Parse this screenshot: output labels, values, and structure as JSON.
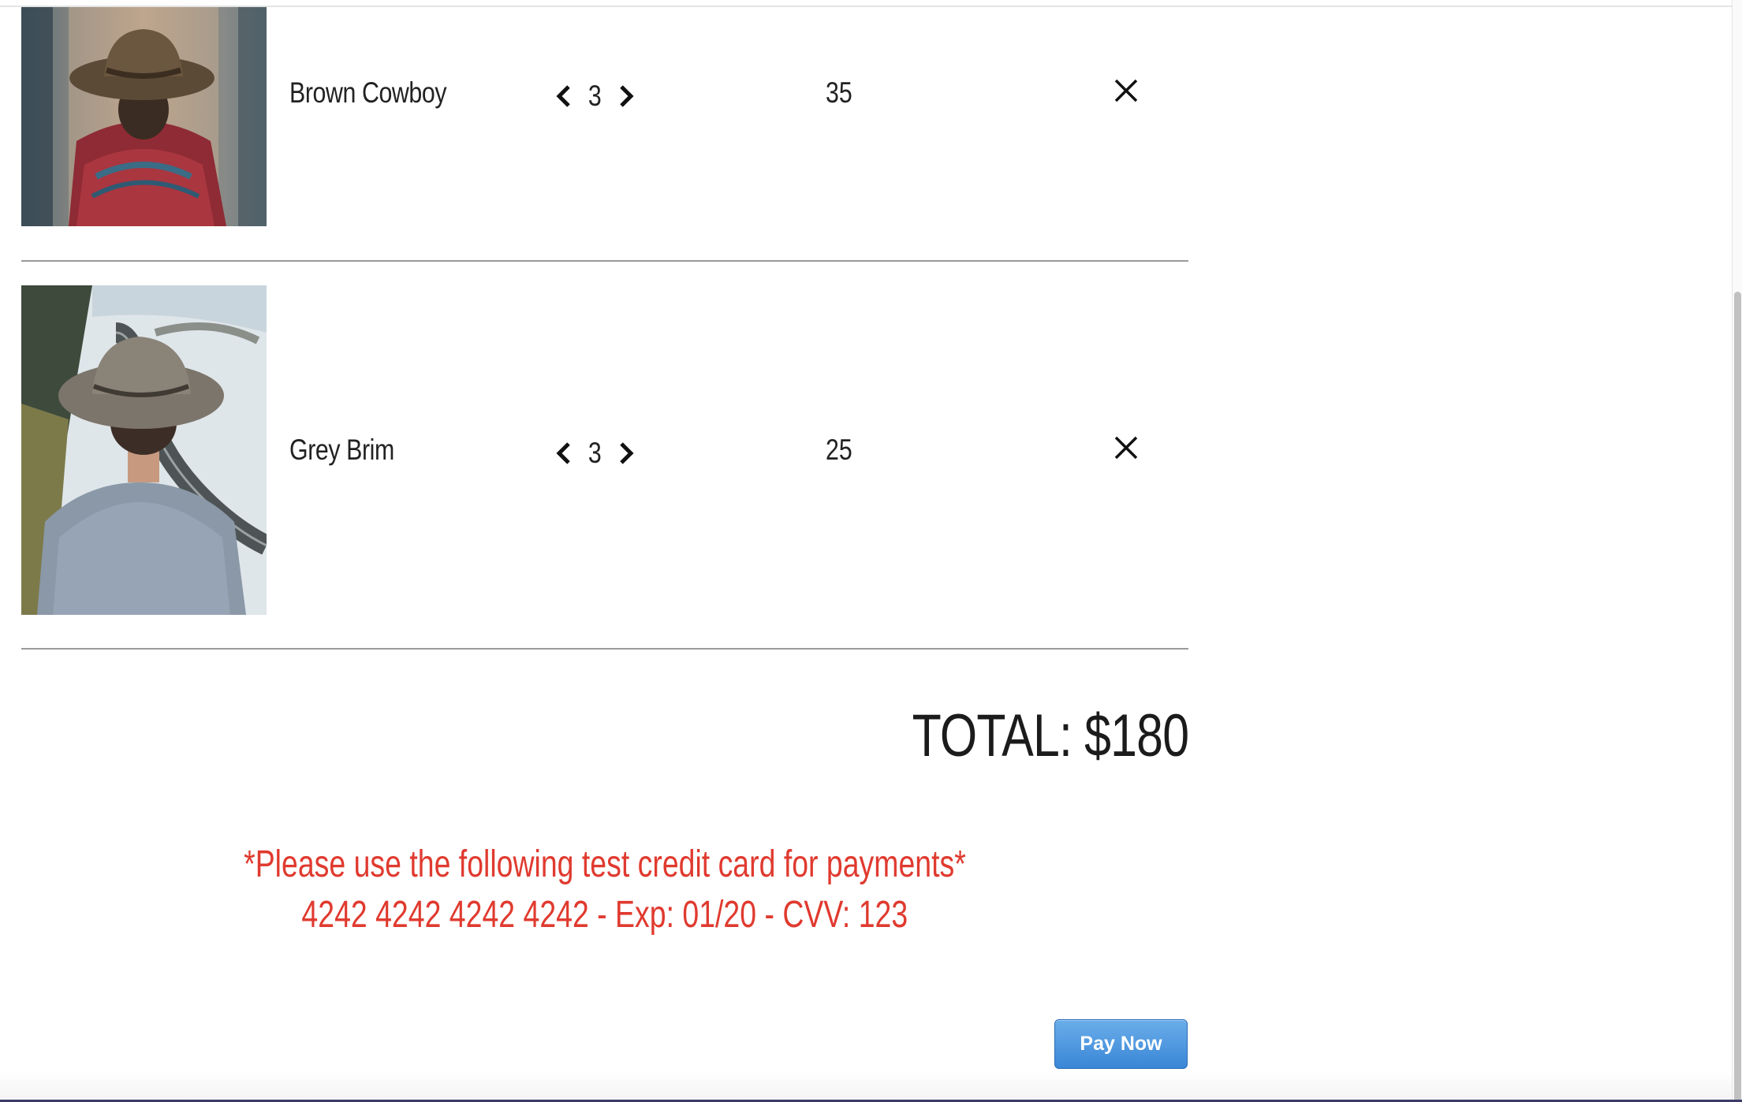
{
  "cart": {
    "items": [
      {
        "name": "Brown Cowboy",
        "quantity": "3",
        "price": "35",
        "image": "man-in-brown-cowboy-hat-photo"
      },
      {
        "name": "Grey Brim",
        "quantity": "3",
        "price": "25",
        "image": "man-in-grey-brim-hat-photo"
      }
    ],
    "icons": {
      "decrement": "chevron-left-icon",
      "increment": "chevron-right-icon",
      "remove": "close-icon"
    }
  },
  "summary": {
    "total": "TOTAL: $180"
  },
  "notice": {
    "line1": "*Please use the following test credit card for payments*",
    "line2": "4242 4242 4242 4242 - Exp: 01/20 - CVV: 123",
    "color": "#e03a2f"
  },
  "payment": {
    "button_label": "Pay Now",
    "button_color": "#3a86d6"
  }
}
